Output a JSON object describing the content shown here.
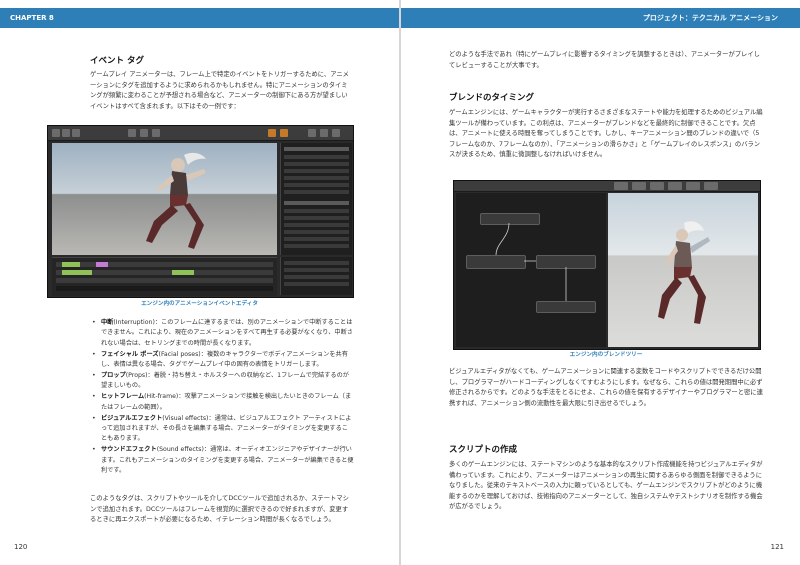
{
  "left": {
    "chapter": "CHAPTER 8",
    "page_number": "120",
    "heading": "イベント タグ",
    "intro": "ゲームプレイ アニメーターは、フレーム上で特定のイベントをトリガーするために、アニメーションにタグを追加するように求められるかもしれません。特にアニメーションのタイミングが頻繁に変わることが予想される場合など、アニメーターの制御下にある方が望ましいイベントはすべて含まれます。以下はその一例です：",
    "figure_caption": "エンジン内のアニメーションイベントエディタ",
    "bullets": [
      {
        "term": "中断",
        "text": "(Interruption)：このフレームに達するまでは、別のアニメーションで中断することはできません。これにより、現在のアニメーションをすべて再生する必要がなくなり、中断されない場合は、セトリングまでの時間が長くなります。"
      },
      {
        "term": "フェイシャル ポーズ",
        "text": "(Facial poses)：複数のキャラクターでボディアニメーションを共有し、表情は異なる場合、タグでゲームプレイ中の固有の表情をトリガーします。"
      },
      {
        "term": "プロップ",
        "text": "(Props)：着脱・持ち替え・ホルスターへの収納など、1フレームで完結するのが望ましいもの。"
      },
      {
        "term": "ヒットフレーム",
        "text": "(Hit-frame)：攻撃アニメーションで接触を検出したいときのフレーム（またはフレームの範囲）。"
      },
      {
        "term": "ビジュアルエフェクト",
        "text": "(Visual effects)：通常は、ビジュアルエフェクト アーティストによって追加されますが、その長さを編集する場合、アニメーターがタイミングを変更することもあります。"
      },
      {
        "term": "サウンドエフェクト",
        "text": "(Sound effects)：通常は、オーディオエンジニアやデザイナーが行います。これもアニメーションのタイミングを変更する場合、アニメーターが編集できると便利です。"
      }
    ],
    "closing": "このようなタグは、スクリプトやツールを介してDCCツールで追加されるか、ステートマシンで追加されます。DCCツールはフレームを視覚的に選択できるので好まれますが、変更するときに再エクスポートが必要になるため、イテレーション時間が長くなるでしょう。"
  },
  "right": {
    "header": "プロジェクト：テクニカル アニメーション",
    "page_number": "121",
    "intro": "どのような手法であれ（特にゲームプレイに影響するタイミングを調整するときは）、アニメーターがプレイしてレビューすることが大事です。",
    "section1_heading": "ブレンドのタイミング",
    "section1_body": "ゲームエンジンには、ゲームキャラクターが実行するさまざまなステートや能力を処理するためのビジュアル編集ツールが備わっています。この利点は、アニメーターがブレンドなどを最終的に制御できることです。欠点は、アニメートに使える時間を奪ってしまうことです。しかし、キーアニメーション間のブレンドの違いで（5フレームなのか、7フレームなのか）、「アニメーションの滑らかさ」と「ゲームプレイのレスポンス」のバランスが決まるため、慎重に微調整しなければいけません。",
    "figure_caption": "エンジン内のブレンドツリー",
    "para2": "ビジュアルエディタがなくても、ゲームアニメーションに関連する変数をコードやスクリプトでできるだけ公開し、プログラマーがハードコーディングしなくてすむようにします。なぜなら、これらの値は開発期間中に必ず修正されるからです。どのような手法をとるにせよ、これらの値を保有するデザイナーやプログラマーと密に連携すれば、アニメーション側の流動性を最大限に引き出せるでしょう。",
    "section2_heading": "スクリプトの作成",
    "section2_body": "多くのゲームエンジンには、ステートマシンのような基本的なスクリプト作成機能を持つビジュアルエディタが備わっています。これにより、アニメーターはアニメーションの再生に関するあらゆる側面を制御できるようになりました。従来のテキストベースの入力に頼っているとしても、ゲームエンジンでスクリプトがどのように機能するのかを理解しておけば、技術指向のアニメーターとして、独自システムやテストシナリオを制作する機会が広がるでしょう。"
  },
  "colors": {
    "accent": "#2e7fb8",
    "keyframe": "#8fc35a"
  },
  "icons": [
    "bullet-icon"
  ]
}
